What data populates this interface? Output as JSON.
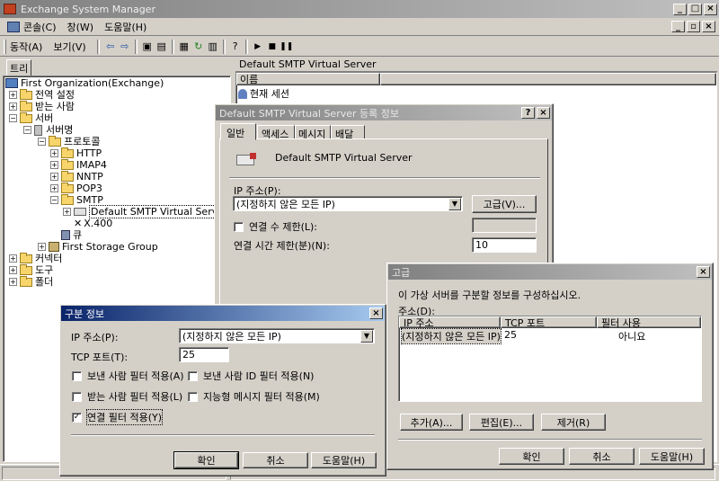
{
  "app": {
    "title": "Exchange System Manager",
    "menu": [
      "콘솔(C)",
      "창(W)",
      "도움말(H)"
    ],
    "toolbar_menu": [
      "동작(A)",
      "보기(V)"
    ],
    "tree_tab": "트리",
    "right_header": "Default SMTP Virtual Server",
    "list_column": "이름",
    "list_item": "현재 세션"
  },
  "tree": [
    {
      "label": "First Organization(Exchange)"
    },
    {
      "label": "전역 설정"
    },
    {
      "label": "받는 사람"
    },
    {
      "label": "서버"
    },
    {
      "label": "서버명"
    },
    {
      "label": "프로토콜"
    },
    {
      "label": "HTTP"
    },
    {
      "label": "IMAP4"
    },
    {
      "label": "NNTP"
    },
    {
      "label": "POP3"
    },
    {
      "label": "SMTP"
    },
    {
      "label": "Default SMTP Virtual Server"
    },
    {
      "label": "X.400"
    },
    {
      "label": "큐"
    },
    {
      "label": "First Storage Group"
    },
    {
      "label": "커넥터"
    },
    {
      "label": "도구"
    },
    {
      "label": "폴더"
    }
  ],
  "props": {
    "title": "Default SMTP Virtual Server 등록 정보",
    "tabs": [
      "일반",
      "액세스",
      "메시지",
      "배달"
    ],
    "server_name": "Default SMTP Virtual Server",
    "ip_label": "IP 주소(P):",
    "ip_value": "(지정하지 않은 모든 IP)",
    "advanced_button": "고급(V)...",
    "limit_conn_label": "연결 수 제한(L):",
    "timeout_label": "연결 시간 제한(분)(N):",
    "timeout_value": "10"
  },
  "advanced": {
    "title": "고급",
    "description": "이 가상 서버를 구분할 정보를 구성하십시오.",
    "address_label": "주소(D):",
    "columns": [
      "IP 주소",
      "TCP 포트",
      "필터 사용"
    ],
    "rows": [
      [
        "(지정하지 않은 모든 IP)",
        "25",
        "아니요"
      ]
    ],
    "add_button": "추가(A)...",
    "edit_button": "편집(E)...",
    "remove_button": "제거(R)",
    "ok_button": "확인",
    "cancel_button": "취소",
    "help_button": "도움말(H)"
  },
  "ident": {
    "title": "구분 정보",
    "ip_label": "IP 주소(P):",
    "ip_value": "(지정하지 않은 모든 IP)",
    "tcp_label": "TCP 포트(T):",
    "tcp_value": "25",
    "checks": [
      {
        "label": "보낸 사람 필터 적용(A)",
        "checked": false
      },
      {
        "label": "보낸 사람 ID 필터 적용(N)",
        "checked": false
      },
      {
        "label": "받는 사람 필터 적용(L)",
        "checked": false
      },
      {
        "label": "지능형 메시지 필터 적용(M)",
        "checked": false
      },
      {
        "label": "연결 필터 적용(Y)",
        "checked": true
      }
    ],
    "ok_button": "확인",
    "cancel_button": "취소",
    "help_button": "도움말(H)"
  }
}
